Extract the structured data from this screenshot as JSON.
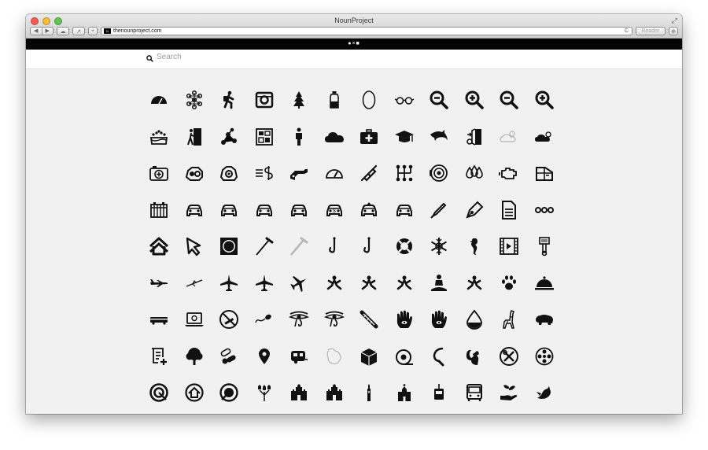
{
  "window": {
    "title": "NounProject"
  },
  "toolbar": {
    "back_glyph": "◀",
    "forward_glyph": "▶",
    "url": "thenounproject.com",
    "favicon_text": "N",
    "reader_label": "Reader",
    "share_glyph": "↗",
    "add_glyph": "+",
    "cloud_glyph": "☁",
    "reload_glyph": "C",
    "download_glyph": "⊕"
  },
  "site": {
    "nav_glyph": "●×■"
  },
  "search": {
    "placeholder": "Search"
  },
  "colors": {
    "icon": "#111111",
    "muted_icon": "#b5b5b5",
    "page_bg": "#f1f1f1"
  },
  "icon_grid": [
    [
      "speedometer-icon",
      "atomium-icon",
      "hiker-icon",
      "instagram-icon",
      "christmas-tree-icon",
      "bottle-icon",
      "ellipse-icon",
      "glasses-icon",
      "zoom-out-icon",
      "zoom-in-icon",
      "zoom-out-icon",
      "zoom-in-icon"
    ],
    [
      "cake-icon",
      "doorway-icon",
      "network-icon",
      "layout-icon",
      "person-icon",
      "cloud-icon",
      "first-aid-icon",
      "graduation-cap-icon",
      "dolphin-icon",
      "exit-icon",
      "cloudy-icon",
      "sun-cloud-icon"
    ],
    [
      "camera-plus-icon",
      "car-engine-icon",
      "car-repair-icon",
      "money-icon",
      "fuel-nozzle-icon",
      "gauge-icon",
      "spark-plug-icon",
      "gearbox-icon",
      "brake-disc-icon",
      "fluid-drops-icon",
      "engine-light-icon",
      "car-door-icon"
    ],
    [
      "radiator-icon",
      "car-front-icon",
      "car-front-icon",
      "car-front-icon",
      "car-front-icon",
      "car-money-icon",
      "car-upgrade-icon",
      "car-front-icon",
      "pen-icon",
      "fountain-pen-icon",
      "document-icon",
      "more-icon"
    ],
    [
      "home-outline-icon",
      "cursor-icon",
      "square-circle-icon",
      "cane-icon",
      "cane-light-icon",
      "hook-icon",
      "hook-icon",
      "lifebuoy-icon",
      "snowflake-icon",
      "seahorse-icon",
      "film-icon",
      "piston-icon"
    ],
    [
      "plane-side-icon",
      "plane-light-icon",
      "plane-top-icon",
      "plane-top-icon",
      "plane-tilted-icon",
      "yoga-pose-icon",
      "yoga-pose-icon",
      "yoga-pose-icon",
      "meditation-icon",
      "yoga-pose-icon",
      "paw-icon",
      "cloche-icon"
    ],
    [
      "bus-side-icon",
      "laptop-icon",
      "no-smoking-icon",
      "sperm-icon",
      "eye-of-horus-icon",
      "eye-of-horus-icon",
      "baguette-icon",
      "hamsa-icon",
      "hamsa-icon",
      "drop-icon",
      "giraffe-icon",
      "bison-icon"
    ],
    [
      "scroll-add-icon",
      "tree-icon",
      "pills-icon",
      "map-pin-icon",
      "caravan-icon",
      "map-icon",
      "package-icon",
      "tape-icon",
      "sickle-icon",
      "squirrel-icon",
      "no-tools-icon",
      "film-reel-icon"
    ],
    [
      "target-icon",
      "home-circle-icon",
      "signal-icon",
      "tulips-icon",
      "castle-icon",
      "castle-icon",
      "tower-icon",
      "church-icon",
      "cable-car-icon",
      "bus-front-icon",
      "plant-hand-icon",
      "bird-icon"
    ]
  ]
}
